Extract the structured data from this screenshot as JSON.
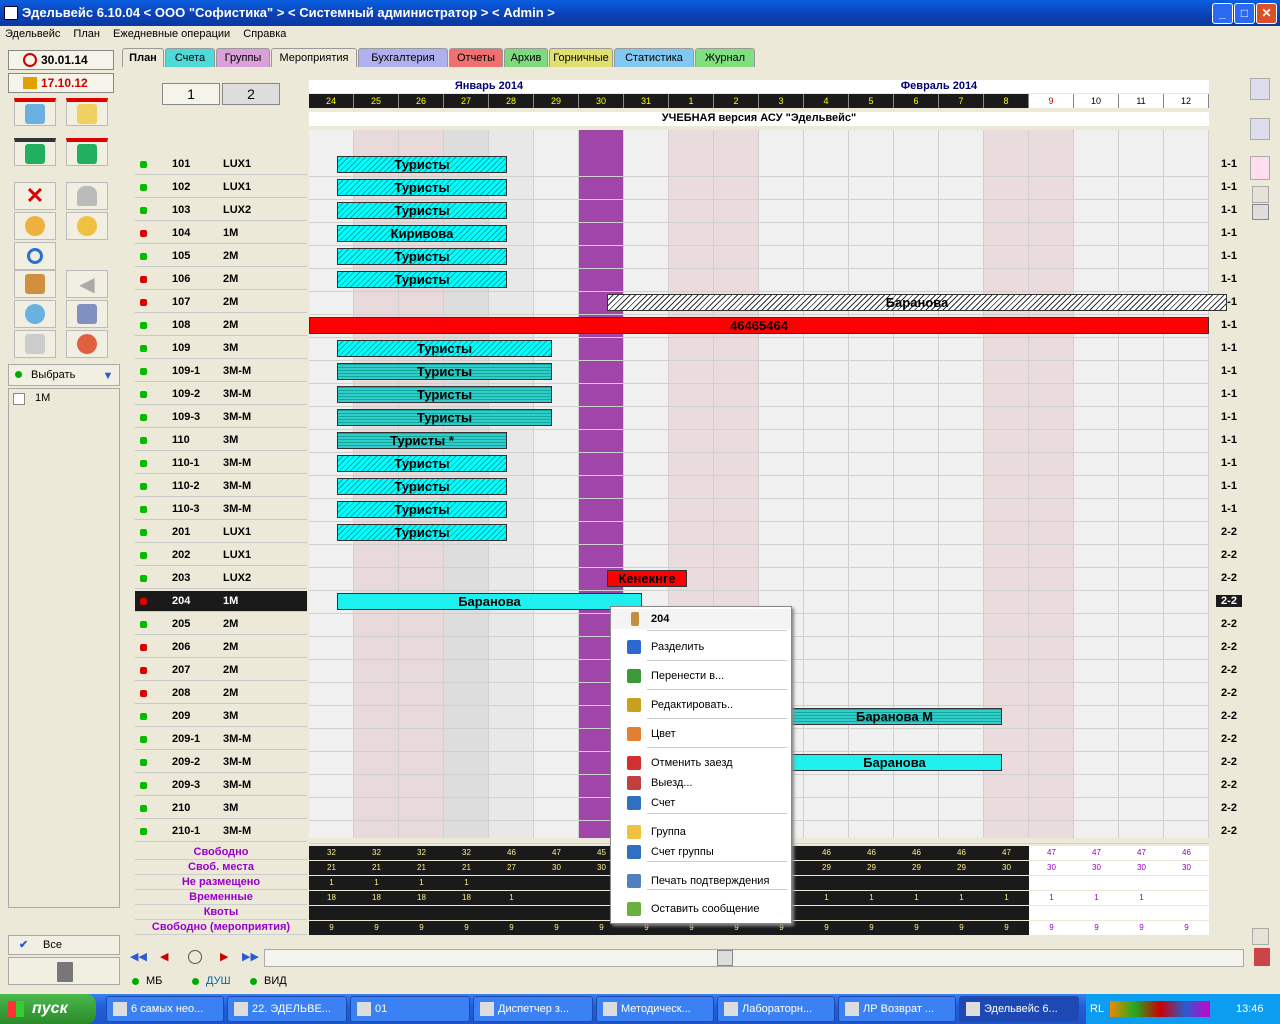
{
  "window": {
    "title": "Эдельвейс 6.10.04 < ООО \"Софистика\" > < Системный администратор > < Admin >",
    "min": "_",
    "max": "□",
    "close": "✕"
  },
  "menu": [
    "Эдельвейс",
    "План",
    "Ежедневные операции",
    "Справка"
  ],
  "left": {
    "date1": "30.01.14",
    "date2": "17.10.12",
    "choose_label": "Выбрать",
    "list_item": "1М",
    "all_label": "Все"
  },
  "tabs": [
    "План",
    "Счета",
    "Группы",
    "Мероприятия",
    "Бухгалтерия",
    "Отчеты",
    "Архив",
    "Горничные",
    "Статистика",
    "Журнал"
  ],
  "tab_colors": [
    "#ece9d8",
    "#4fd9d9",
    "#d9a0d9",
    "#ece9d8",
    "#b0b0f0",
    "#f07070",
    "#7fd97f",
    "#e0e070",
    "#80c8f0",
    "#80e080"
  ],
  "view_buttons": [
    "1",
    "2"
  ],
  "months": [
    "Январь 2014",
    "Февраль 2014"
  ],
  "days": [
    "24",
    "25",
    "26",
    "27",
    "28",
    "29",
    "30",
    "31",
    "1",
    "2",
    "3",
    "4",
    "5",
    "6",
    "7",
    "8",
    "9",
    "10",
    "11",
    "12"
  ],
  "banner": "УЧЕБНАЯ версия АСУ \"Эдельвейс\"",
  "rooms": [
    {
      "num": "101",
      "type": "LUX1",
      "status": "green",
      "right": "1-1"
    },
    {
      "num": "102",
      "type": "LUX1",
      "status": "green",
      "right": "1-1"
    },
    {
      "num": "103",
      "type": "LUX2",
      "status": "green",
      "right": "1-1"
    },
    {
      "num": "104",
      "type": "1М",
      "status": "red",
      "right": "1-1"
    },
    {
      "num": "105",
      "type": "2М",
      "status": "green",
      "right": "1-1"
    },
    {
      "num": "106",
      "type": "2М",
      "status": "red",
      "right": "1-1"
    },
    {
      "num": "107",
      "type": "2М",
      "status": "red",
      "right": "1-1"
    },
    {
      "num": "108",
      "type": "2М",
      "status": "green",
      "right": "1-1"
    },
    {
      "num": "109",
      "type": "3М",
      "status": "green",
      "right": "1-1"
    },
    {
      "num": "109-1",
      "type": "3М-М",
      "status": "green",
      "right": "1-1"
    },
    {
      "num": "109-2",
      "type": "3М-М",
      "status": "green",
      "right": "1-1"
    },
    {
      "num": "109-3",
      "type": "3М-М",
      "status": "green",
      "right": "1-1"
    },
    {
      "num": "110",
      "type": "3М",
      "status": "green",
      "right": "1-1"
    },
    {
      "num": "110-1",
      "type": "3М-М",
      "status": "green",
      "right": "1-1"
    },
    {
      "num": "110-2",
      "type": "3М-М",
      "status": "green",
      "right": "1-1"
    },
    {
      "num": "110-3",
      "type": "3М-М",
      "status": "green",
      "right": "1-1"
    },
    {
      "num": "201",
      "type": "LUX1",
      "status": "green",
      "right": "2-2"
    },
    {
      "num": "202",
      "type": "LUX1",
      "status": "green",
      "right": "2-2"
    },
    {
      "num": "203",
      "type": "LUX2",
      "status": "green",
      "right": "2-2"
    },
    {
      "num": "204",
      "type": "1М",
      "status": "red",
      "right": "2-2"
    },
    {
      "num": "205",
      "type": "2М",
      "status": "green",
      "right": "2-2"
    },
    {
      "num": "206",
      "type": "2М",
      "status": "red",
      "right": "2-2"
    },
    {
      "num": "207",
      "type": "2М",
      "status": "red",
      "right": "2-2"
    },
    {
      "num": "208",
      "type": "2М",
      "status": "red",
      "right": "2-2"
    },
    {
      "num": "209",
      "type": "3М",
      "status": "green",
      "right": "2-2"
    },
    {
      "num": "209-1",
      "type": "3М-М",
      "status": "green",
      "right": "2-2"
    },
    {
      "num": "209-2",
      "type": "3М-М",
      "status": "green",
      "right": "2-2"
    },
    {
      "num": "209-3",
      "type": "3М-М",
      "status": "green",
      "right": "2-2"
    },
    {
      "num": "210",
      "type": "3М",
      "status": "green",
      "right": "2-2"
    },
    {
      "num": "210-1",
      "type": "3М-М",
      "status": "green",
      "right": "2-2"
    }
  ],
  "bookings": [
    {
      "row": 0,
      "label": "Туристы",
      "style": "cyan",
      "from": "24",
      "to": "27"
    },
    {
      "row": 1,
      "label": "Туристы",
      "style": "cyan",
      "from": "24",
      "to": "27"
    },
    {
      "row": 2,
      "label": "Туристы",
      "style": "cyan",
      "from": "24",
      "to": "27"
    },
    {
      "row": 3,
      "label": "Киривова",
      "style": "cyan",
      "from": "24",
      "to": "27"
    },
    {
      "row": 4,
      "label": "Туристы",
      "style": "cyan",
      "from": "24",
      "to": "27"
    },
    {
      "row": 5,
      "label": "Туристы",
      "style": "cyan",
      "from": "24",
      "to": "27"
    },
    {
      "row": 6,
      "label": "Баранова",
      "style": "white",
      "from": "30",
      "to": "12"
    },
    {
      "row": 7,
      "label": "46465464",
      "style": "red",
      "from": "24",
      "to": "12"
    },
    {
      "row": 8,
      "label": "Туристы",
      "style": "cyan",
      "from": "24",
      "to": "28"
    },
    {
      "row": 9,
      "label": "Туристы",
      "style": "teal",
      "from": "24",
      "to": "28"
    },
    {
      "row": 10,
      "label": "Туристы",
      "style": "teal",
      "from": "24",
      "to": "28"
    },
    {
      "row": 11,
      "label": "Туристы",
      "style": "teal",
      "from": "24",
      "to": "28"
    },
    {
      "row": 12,
      "label": "Туристы *",
      "style": "teal",
      "from": "24",
      "to": "27"
    },
    {
      "row": 13,
      "label": "Туристы",
      "style": "cyan",
      "from": "24",
      "to": "27"
    },
    {
      "row": 14,
      "label": "Туристы",
      "style": "cyan",
      "from": "24",
      "to": "27"
    },
    {
      "row": 15,
      "label": "Туристы",
      "style": "cyan",
      "from": "24",
      "to": "27"
    },
    {
      "row": 16,
      "label": "Туристы",
      "style": "cyan",
      "from": "24",
      "to": "27"
    },
    {
      "row": 18,
      "label": "Кенекнге",
      "style": "red",
      "from": "30",
      "to": "31"
    },
    {
      "row": 19,
      "label": "Баранова",
      "style": "cyanflat",
      "from": "24",
      "to": "30"
    },
    {
      "row": 24,
      "label": "Баранова М",
      "style": "teal",
      "from": "3",
      "to": "7"
    },
    {
      "row": 26,
      "label": "Баранова",
      "style": "cyanflat",
      "from": "3",
      "to": "7"
    }
  ],
  "summary": {
    "labels": [
      "Свободно",
      "Своб. места",
      "Не размещено",
      "Временные",
      "Квоты",
      "Свободно (мероприятия)"
    ],
    "rows": [
      [
        "32",
        "32",
        "32",
        "32",
        "46",
        "47",
        "45",
        "",
        "",
        "",
        "",
        "46",
        "46",
        "46",
        "46",
        "47",
        "47",
        "47",
        "47",
        "46"
      ],
      [
        "21",
        "21",
        "21",
        "21",
        "27",
        "30",
        "30",
        "",
        "",
        "",
        "",
        "29",
        "29",
        "29",
        "29",
        "30",
        "30",
        "30",
        "30",
        "30"
      ],
      [
        "1",
        "1",
        "1",
        "1",
        "",
        "",
        "",
        "",
        "",
        "",
        "",
        "",
        "",
        "",
        "",
        "",
        "",
        "",
        "",
        ""
      ],
      [
        "18",
        "18",
        "18",
        "18",
        "1",
        "",
        "",
        "",
        "",
        "",
        "",
        "1",
        "1",
        "1",
        "1",
        "1",
        "1",
        "1",
        "1",
        ""
      ],
      [
        "",
        "",
        "",
        "",
        "",
        "",
        "",
        "",
        "",
        "",
        "",
        "",
        "",
        "",
        "",
        "",
        "",
        "",
        "",
        ""
      ],
      [
        "9",
        "9",
        "9",
        "9",
        "9",
        "9",
        "9",
        "9",
        "9",
        "9",
        "9",
        "9",
        "9",
        "9",
        "9",
        "9",
        "9",
        "9",
        "9",
        "9"
      ]
    ]
  },
  "context_menu": {
    "header": "204",
    "items": [
      "Разделить",
      "Перенести в...",
      "Редактировать..",
      "Цвет",
      "Отменить заезд",
      "Выезд...",
      "Счет",
      "Группа",
      "Счет группы",
      "Печать подтверждения",
      "Оставить сообщение"
    ]
  },
  "status": {
    "mb": "МБ",
    "dush": "ДУШ",
    "vid": "ВИД"
  },
  "taskbar": {
    "start": "пуск",
    "tasks": [
      "6 самых нео...",
      "22. ЭДЕЛЬВЕ...",
      "01",
      "Диспетчер з...",
      "Методическ...",
      "Лабораторн...",
      "ЛР Возврат ...",
      "Эдельвейс 6..."
    ],
    "lang": "RL",
    "time": "13:46"
  },
  "colors": {
    "weekend": "#e8d8d8",
    "purple": "#a040a0",
    "dark": "#1a1a1a"
  }
}
